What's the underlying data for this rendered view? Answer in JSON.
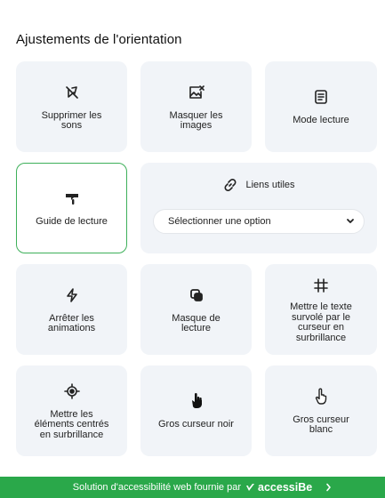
{
  "section": {
    "title": "Ajustements de l'orientation"
  },
  "tiles": [
    {
      "id": "mute",
      "label": "Supprimer les sons",
      "icon": "mute-icon"
    },
    {
      "id": "hide-images",
      "label": "Masquer les images",
      "icon": "hide-images-icon"
    },
    {
      "id": "read-mode",
      "label": "Mode lecture",
      "icon": "document-icon"
    },
    {
      "id": "reading-guide",
      "label": "Guide de lecture",
      "icon": "reading-guide-icon",
      "active": true
    },
    {
      "id": "stop-animations",
      "label": "Arrêter les animations",
      "icon": "lightning-icon"
    },
    {
      "id": "reading-mask",
      "label": "Masque de lecture",
      "icon": "mask-icon"
    },
    {
      "id": "highlight-hover",
      "label": "Mettre le texte survolé par le curseur en surbrillance",
      "icon": "hash-icon"
    },
    {
      "id": "highlight-focus",
      "label": "Mettre les éléments centrés en surbrillance",
      "icon": "target-icon"
    },
    {
      "id": "big-black-cursor",
      "label": "Gros curseur noir",
      "icon": "black-cursor-icon"
    },
    {
      "id": "big-white-cursor",
      "label": "Gros curseur blanc",
      "icon": "white-cursor-icon"
    }
  ],
  "useful_links": {
    "title": "Liens utiles",
    "icon": "link-icon",
    "select_value": "Sélectionner une option"
  },
  "footer": {
    "text": "Solution d'accessibilité web fournie par",
    "brand": "accessiBe"
  },
  "colors": {
    "accent": "#2aa84a",
    "tile_bg": "#f1f4f8",
    "active_border": "#3eb05a"
  }
}
